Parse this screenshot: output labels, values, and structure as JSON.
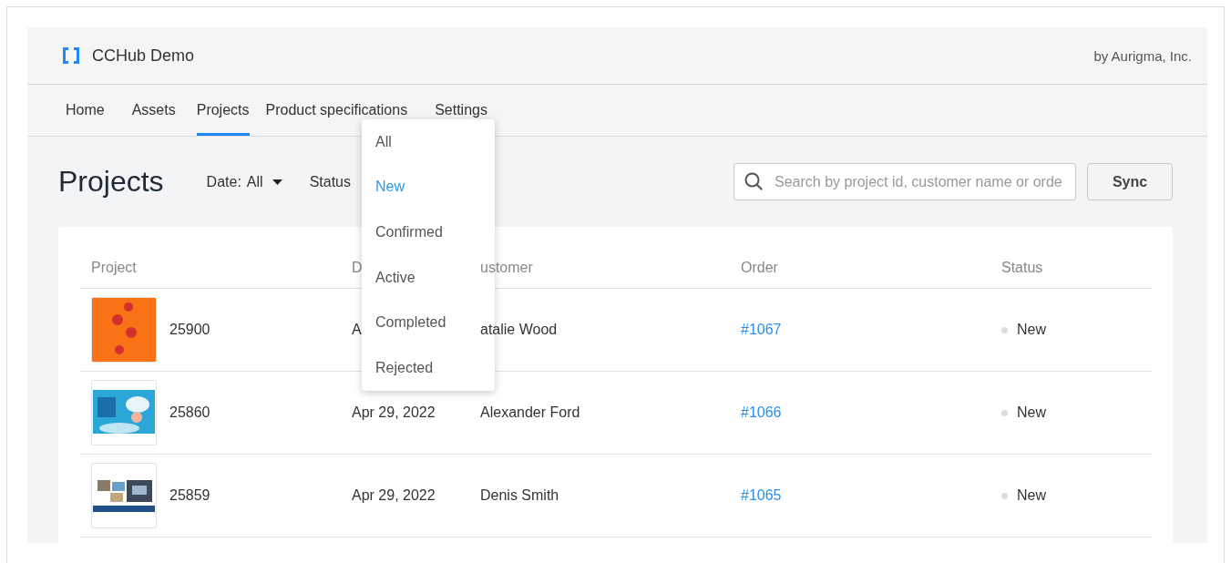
{
  "header": {
    "brand": "CCHub Demo",
    "vendor": "by Aurigma, Inc."
  },
  "nav": {
    "items": [
      {
        "label": "Home",
        "selected": false
      },
      {
        "label": "Assets",
        "selected": false
      },
      {
        "label": "Projects",
        "selected": true
      },
      {
        "label": "Product specifications",
        "selected": false
      },
      {
        "label": "Settings",
        "selected": false
      }
    ]
  },
  "page": {
    "title": "Projects",
    "date_filter": {
      "label": "Date:",
      "value": "All"
    },
    "status_filter": {
      "label": "Status"
    },
    "search": {
      "placeholder": "Search by project id, customer name or orde"
    },
    "sync_button": "Sync"
  },
  "table": {
    "columns": [
      "Project",
      "D",
      "ustomer",
      "Order",
      "Status"
    ],
    "rows": [
      {
        "project": "25900",
        "date": "A",
        "customer": "atalie Wood",
        "order": "#1067",
        "status": "New"
      },
      {
        "project": "25860",
        "date": "Apr 29, 2022",
        "customer": "Alexander Ford",
        "order": "#1066",
        "status": "New"
      },
      {
        "project": "25859",
        "date": "Apr 29, 2022",
        "customer": "Denis Smith",
        "order": "#1065",
        "status": "New"
      }
    ]
  },
  "status_menu": {
    "items": [
      {
        "label": "All",
        "selected": false
      },
      {
        "label": "New",
        "selected": true
      },
      {
        "label": "Confirmed",
        "selected": false
      },
      {
        "label": "Active",
        "selected": false
      },
      {
        "label": "Completed",
        "selected": false
      },
      {
        "label": "Rejected",
        "selected": false
      }
    ]
  }
}
